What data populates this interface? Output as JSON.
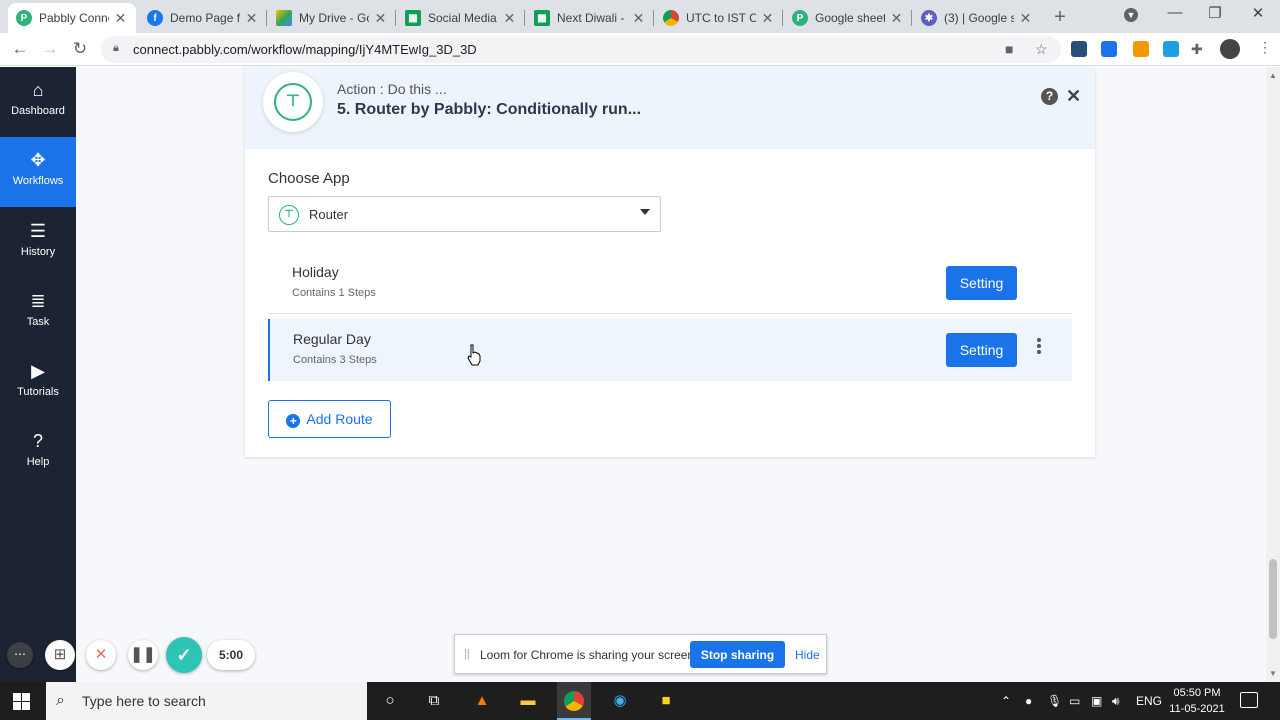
{
  "browser": {
    "tabs": [
      {
        "title": "Pabbly Conne",
        "icon": "pabbly-icon",
        "color": "#2db37c",
        "active": true
      },
      {
        "title": "Demo Page fo",
        "icon": "facebook-icon",
        "color": "#1877f2"
      },
      {
        "title": "My Drive - Go",
        "icon": "google-drive-icon",
        "color": "#fbbc04"
      },
      {
        "title": "Social Media",
        "icon": "google-sheets-icon",
        "color": "#0f9d58"
      },
      {
        "title": "Next Diwali -",
        "icon": "google-sheets-icon",
        "color": "#0f9d58"
      },
      {
        "title": "UTC to IST Co",
        "icon": "chrome-icon",
        "color": "#db4437"
      },
      {
        "title": "Google sheet",
        "icon": "pabbly-icon",
        "color": "#2db37c"
      },
      {
        "title": "(3) | Google s",
        "icon": "gear-icon",
        "color": "#5b5fc7"
      }
    ],
    "url": "connect.pabbly.com/workflow/mapping/IjY4MTEwIg_3D_3D"
  },
  "sidebar": {
    "items": [
      {
        "label": "Dashboard",
        "icon": "home-icon"
      },
      {
        "label": "Workflows",
        "icon": "workflow-icon",
        "active": true
      },
      {
        "label": "History",
        "icon": "history-icon"
      },
      {
        "label": "Task",
        "icon": "task-icon"
      },
      {
        "label": "Tutorials",
        "icon": "play-icon"
      },
      {
        "label": "Help",
        "icon": "help-icon"
      }
    ]
  },
  "action": {
    "subtitle": "Action : Do this ...",
    "title": "5. Router by Pabbly: Conditionally run..."
  },
  "choose_app": {
    "label": "Choose App",
    "selected": "Router"
  },
  "routes": [
    {
      "name": "Holiday",
      "steps": "Contains 1 Steps",
      "button": "Setting"
    },
    {
      "name": "Regular Day",
      "steps": "Contains 3 Steps",
      "button": "Setting"
    }
  ],
  "add_route_label": "Add Route",
  "loom": {
    "timer": "5:00",
    "share_message": "Loom for Chrome is sharing your screen.",
    "stop_label": "Stop sharing",
    "hide_label": "Hide"
  },
  "taskbar": {
    "search_placeholder": "Type here to search",
    "language": "ENG",
    "time": "05:50 PM",
    "date": "11-05-2021"
  },
  "colors": {
    "accent": "#1a73e8",
    "sidebar_bg": "#1c2333",
    "router_green": "#2db37c"
  }
}
